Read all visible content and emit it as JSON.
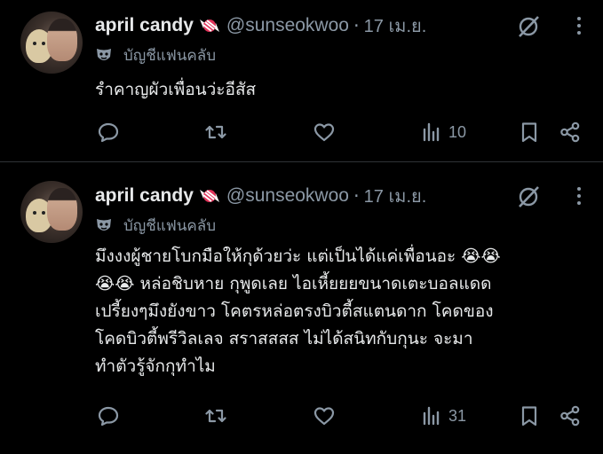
{
  "tweets": [
    {
      "display_name": "april candy",
      "handle": "@sunseokwoo",
      "separator": "·",
      "time": "17 เม.ย.",
      "community": "บัญชีแฟนคลับ",
      "text": "รำคาญผัวเพื่อนว่ะอีสัส",
      "views": "10"
    },
    {
      "display_name": "april candy",
      "handle": "@sunseokwoo",
      "separator": "·",
      "time": "17 เม.ย.",
      "community": "บัญชีแฟนคลับ",
      "text": "มึงงงผู้ชายโบกมือให้กุด้วยว่ะ แต่เป็นได้แค่เพื่อนอะ 😭😭\n😭😭 หล่อชิบหาย กุพูดเลย ไอเหี้ยยยขนาดเตะบอลแดด\nเปรี้ยงๆมึงยังขาว โคตรหล่อตรงบิวตี้สแตนดาก โคดของ\nโคดบิวตี้พรีวิลเลจ สราสสสส ไม่ได้สนิทกับกุนะ จะมา\nทำตัวรู้จักกุทำไม",
      "views": "31"
    }
  ],
  "icons": {
    "reply": "reply-icon",
    "retweet": "retweet-icon",
    "like": "heart-icon",
    "views": "views-icon",
    "bookmark": "bookmark-icon",
    "share": "share-icon",
    "grok": "grok-icon",
    "more": "more-icon",
    "community": "mask-icon",
    "candy": "candy-icon"
  },
  "colors": {
    "background": "#000000",
    "text": "#e7e9ea",
    "secondary": "#8b98a5",
    "divider": "#2f3336"
  }
}
